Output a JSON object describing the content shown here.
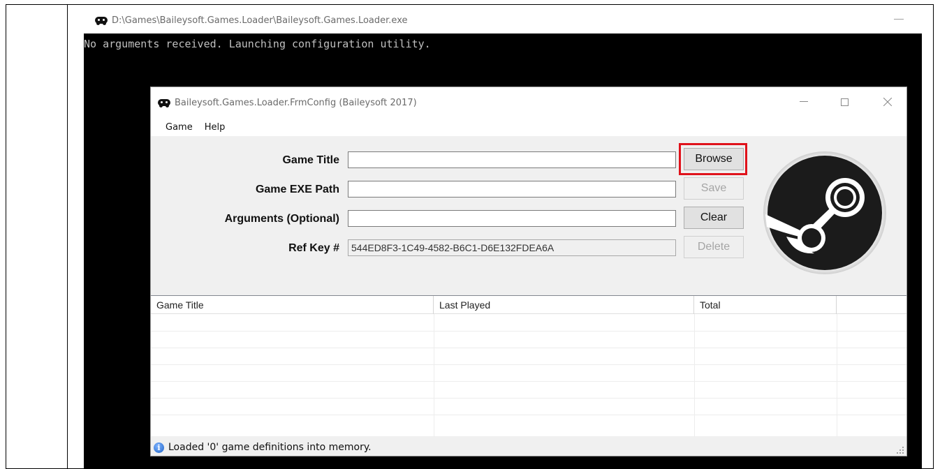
{
  "console": {
    "title": "D:\\Games\\Baileysoft.Games.Loader\\Baileysoft.Games.Loader.exe",
    "output_line": "No arguments received. Launching configuration utility.",
    "minimize_glyph": "—"
  },
  "form": {
    "title": "Baileysoft.Games.Loader.FrmConfig (Baileysoft 2017)",
    "menu": [
      "Game",
      "Help"
    ],
    "fields": {
      "game_title": {
        "label": "Game Title",
        "value": ""
      },
      "game_exe_path": {
        "label": "Game EXE Path",
        "value": ""
      },
      "arguments": {
        "label": "Arguments (Optional)",
        "value": ""
      },
      "ref_key": {
        "label": "Ref Key #",
        "value": "544ED8F3-1C49-4582-B6C1-D6E132FDEA6A"
      }
    },
    "buttons": {
      "browse": "Browse",
      "save": "Save",
      "clear": "Clear",
      "delete": "Delete"
    },
    "list_columns": [
      "Game Title",
      "Last Played",
      "Total",
      ""
    ],
    "status_text": "Loaded '0' game definitions into memory."
  },
  "colors": {
    "console_bg": "#000000",
    "highlight": "#e0121b",
    "steam_dark": "#1b1b1b"
  },
  "icons": {
    "app": "gamepad-icon",
    "status": "info-icon",
    "logo": "steam-logo"
  }
}
